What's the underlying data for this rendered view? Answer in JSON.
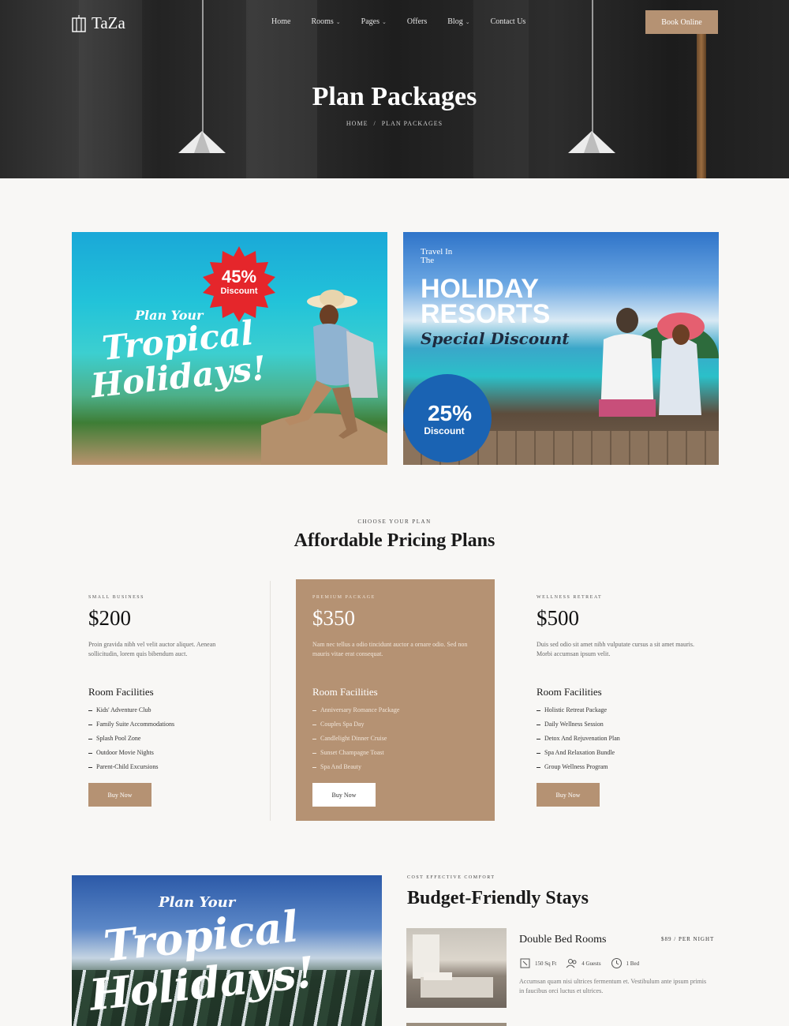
{
  "header": {
    "logo": "TaZa",
    "nav": [
      {
        "label": "Home",
        "dropdown": false
      },
      {
        "label": "Rooms",
        "dropdown": true
      },
      {
        "label": "Pages",
        "dropdown": true
      },
      {
        "label": "Offers",
        "dropdown": false
      },
      {
        "label": "Blog",
        "dropdown": true
      },
      {
        "label": "Contact Us",
        "dropdown": false
      }
    ],
    "book_button": "Book Online"
  },
  "hero": {
    "title": "Plan Packages",
    "breadcrumb": [
      "Home",
      "Plan Packages"
    ],
    "breadcrumb_separator": "/"
  },
  "promos": [
    {
      "script_top": "Plan Your",
      "headline_1": "Tropical",
      "headline_2": "Holidays!",
      "badge_value": "45%",
      "badge_label": "Discount",
      "badge_color": "#e5262b"
    },
    {
      "travel_line_1": "Travel In",
      "travel_line_2": "The",
      "headline_1": "HOLIDAY",
      "headline_2": "RESORTS",
      "script": "Special Discount",
      "badge_value": "25%",
      "badge_label": "Discount",
      "badge_color": "#1a63b3"
    }
  ],
  "pricing": {
    "eyebrow": "Choose Your Plan",
    "title": "Affordable Pricing Plans",
    "plans": [
      {
        "label": "Small Business",
        "price": "$200",
        "desc": "Proin gravida nibh vel velit auctor aliquet. Aenean sollicitudin, lorem quis bibendum auct.",
        "facilities_title": "Room Facilities",
        "items": [
          "Kids' Adventure Club",
          "Family Suite Accommodations",
          "Splash Pool Zone",
          "Outdoor Movie Nights",
          "Parent-Child Excursions"
        ],
        "button": "Buy Now",
        "featured": false
      },
      {
        "label": "Premium Package",
        "price": "$350",
        "desc": "Nam nec tellus a odio tincidunt auctor a ornare odio. Sed non mauris vitae erat consequat.",
        "facilities_title": "Room Facilities",
        "items": [
          "Anniversary Romance Package",
          "Couples Spa Day",
          "Candlelight Dinner Cruise",
          "Sunset Champagne Toast",
          "Spa And Beauty"
        ],
        "button": "Buy Now",
        "featured": true
      },
      {
        "label": "Wellness Retreat",
        "price": "$500",
        "desc": "Duis sed odio sit amet nibh vulputate cursus a sit amet mauris. Morbi accumsan ipsum velit.",
        "facilities_title": "Room Facilities",
        "items": [
          "Holistic Retreat Package",
          "Daily Wellness Session",
          "Detox And Rejuvenation Plan",
          "Spa And Relaxation Bundle",
          "Group Wellness Program"
        ],
        "button": "Buy Now",
        "featured": false
      }
    ]
  },
  "budget": {
    "eyebrow": "Cost Effective Comfort",
    "title": "Budget-Friendly Stays",
    "image_script": "Plan Your",
    "image_headline_1": "Tropical",
    "image_headline_2": "Holidays!",
    "room": {
      "name": "Double Bed Rooms",
      "price": "$89 / Per Night",
      "meta": [
        {
          "icon": "area-icon",
          "text": "150 Sq Ft"
        },
        {
          "icon": "guests-icon",
          "text": "4 Guests"
        },
        {
          "icon": "clock-icon",
          "text": "1 Bed"
        }
      ],
      "desc": "Accumsan quam nisi ultrices fermentum et. Vestibulum ante ipsum primis in faucibus orci luctus et ultrices."
    }
  },
  "colors": {
    "accent": "#b59273",
    "hero_bg": "#232323",
    "page_bg": "#f8f7f5"
  }
}
